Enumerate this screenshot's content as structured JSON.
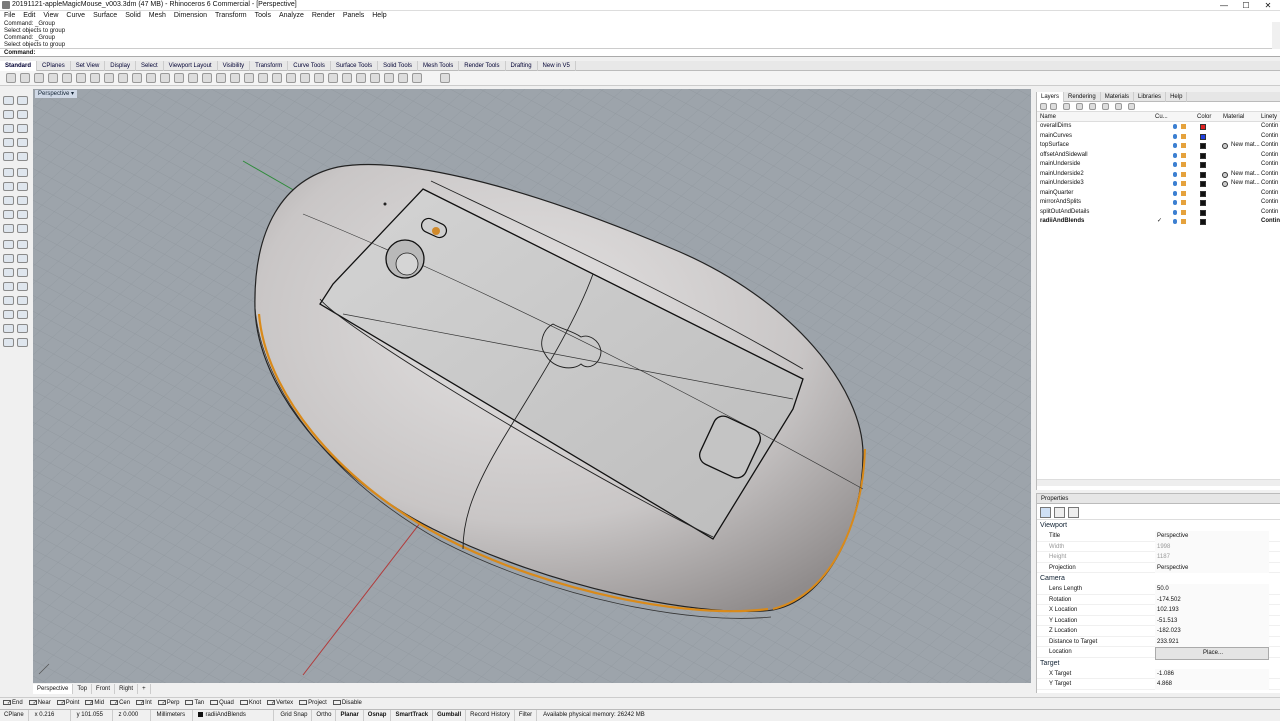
{
  "window": {
    "title": "20191121-appleMagicMouse_v003.3dm (47 MB) - Rhinoceros 6 Commercial - [Perspective]",
    "min": "—",
    "max": "☐",
    "close": "✕"
  },
  "menu": [
    "File",
    "Edit",
    "View",
    "Curve",
    "Surface",
    "Solid",
    "Mesh",
    "Dimension",
    "Transform",
    "Tools",
    "Analyze",
    "Render",
    "Panels",
    "Help"
  ],
  "command_history": [
    "Command: _Group",
    "Select objects to group",
    "Command: _Group",
    "Select objects to group"
  ],
  "command_prompt": "Command:",
  "toolbar_tabs": [
    "Standard",
    "CPlanes",
    "Set View",
    "Display",
    "Select",
    "Viewport Layout",
    "Visibility",
    "Transform",
    "Curve Tools",
    "Surface Tools",
    "Solid Tools",
    "Mesh Tools",
    "Render Tools",
    "Drafting",
    "New in V5"
  ],
  "viewport": {
    "label": "Perspective ▾"
  },
  "viewport_tabs": [
    "Perspective",
    "Top",
    "Front",
    "Right",
    "+"
  ],
  "osnaps": [
    {
      "label": "End",
      "on": true
    },
    {
      "label": "Near",
      "on": true
    },
    {
      "label": "Point",
      "on": true
    },
    {
      "label": "Mid",
      "on": true
    },
    {
      "label": "Cen",
      "on": true
    },
    {
      "label": "Int",
      "on": true
    },
    {
      "label": "Perp",
      "on": true
    },
    {
      "label": "Tan",
      "on": false
    },
    {
      "label": "Quad",
      "on": false
    },
    {
      "label": "Knot",
      "on": false
    },
    {
      "label": "Vertex",
      "on": true
    },
    {
      "label": "Project",
      "on": false
    },
    {
      "label": "Disable",
      "on": false
    }
  ],
  "status": {
    "cplane": "CPlane",
    "x": "x 0.216",
    "y": "y 101.055",
    "z": "z 0.000",
    "units": "Millimeters",
    "layer": "radiiAndBlends",
    "items": [
      "Grid Snap",
      "Ortho",
      "Planar",
      "Osnap",
      "SmartTrack",
      "Gumball",
      "Record History",
      "Filter"
    ],
    "bold": [
      "Planar",
      "Osnap",
      "SmartTrack",
      "Gumball"
    ],
    "memory": "Available physical memory: 26242 MB"
  },
  "layers_panel": {
    "tabs": [
      "Layers",
      "Rendering",
      "Materials",
      "Libraries",
      "Help"
    ],
    "columns": [
      "Name",
      "Cu...",
      "Color",
      "Material",
      "Linety"
    ],
    "rows": [
      {
        "name": "overallDims",
        "color": "#e02020",
        "material": "",
        "linetype": "Contin"
      },
      {
        "name": "mainCurves",
        "color": "#2040e0",
        "material": "",
        "linetype": "Contin"
      },
      {
        "name": "topSurface",
        "color": "#111111",
        "material": "New mat...",
        "linetype": "Contin"
      },
      {
        "name": "offsetAndSidewall",
        "color": "#111111",
        "material": "",
        "linetype": "Contin"
      },
      {
        "name": "mainUnderside",
        "color": "#111111",
        "material": "",
        "linetype": "Contin"
      },
      {
        "name": "mainUnderside2",
        "color": "#111111",
        "material": "New mat...",
        "linetype": "Contin"
      },
      {
        "name": "mainUnderside3",
        "color": "#111111",
        "material": "New mat...",
        "linetype": "Contin"
      },
      {
        "name": "mainQuarter",
        "color": "#111111",
        "material": "",
        "linetype": "Contin"
      },
      {
        "name": "mirrorAndSplits",
        "color": "#111111",
        "material": "",
        "linetype": "Contin"
      },
      {
        "name": "splitOutAndDetails",
        "color": "#111111",
        "material": "",
        "linetype": "Contin"
      },
      {
        "name": "radiiAndBlends",
        "color": "#111111",
        "material": "",
        "linetype": "Contin",
        "current": true
      }
    ],
    "current_mark": "✓"
  },
  "properties_panel": {
    "tab": "Properties",
    "sections": [
      {
        "title": "Viewport",
        "rows": [
          {
            "k": "Title",
            "v": "Perspective"
          },
          {
            "k": "Width",
            "v": "1998",
            "disabled": true
          },
          {
            "k": "Height",
            "v": "1187",
            "disabled": true
          },
          {
            "k": "Projection",
            "v": "Perspective"
          }
        ]
      },
      {
        "title": "Camera",
        "rows": [
          {
            "k": "Lens Length",
            "v": "50.0"
          },
          {
            "k": "Rotation",
            "v": "-174.502"
          },
          {
            "k": "X Location",
            "v": "102.193"
          },
          {
            "k": "Y Location",
            "v": "-51.513"
          },
          {
            "k": "Z Location",
            "v": "-182.023"
          },
          {
            "k": "Distance to Target",
            "v": "233.921"
          },
          {
            "k": "Location",
            "v": "Place..."
          }
        ]
      },
      {
        "title": "Target",
        "rows": [
          {
            "k": "X Target",
            "v": "-1.086"
          },
          {
            "k": "Y Target",
            "v": "4.868"
          }
        ]
      }
    ]
  }
}
